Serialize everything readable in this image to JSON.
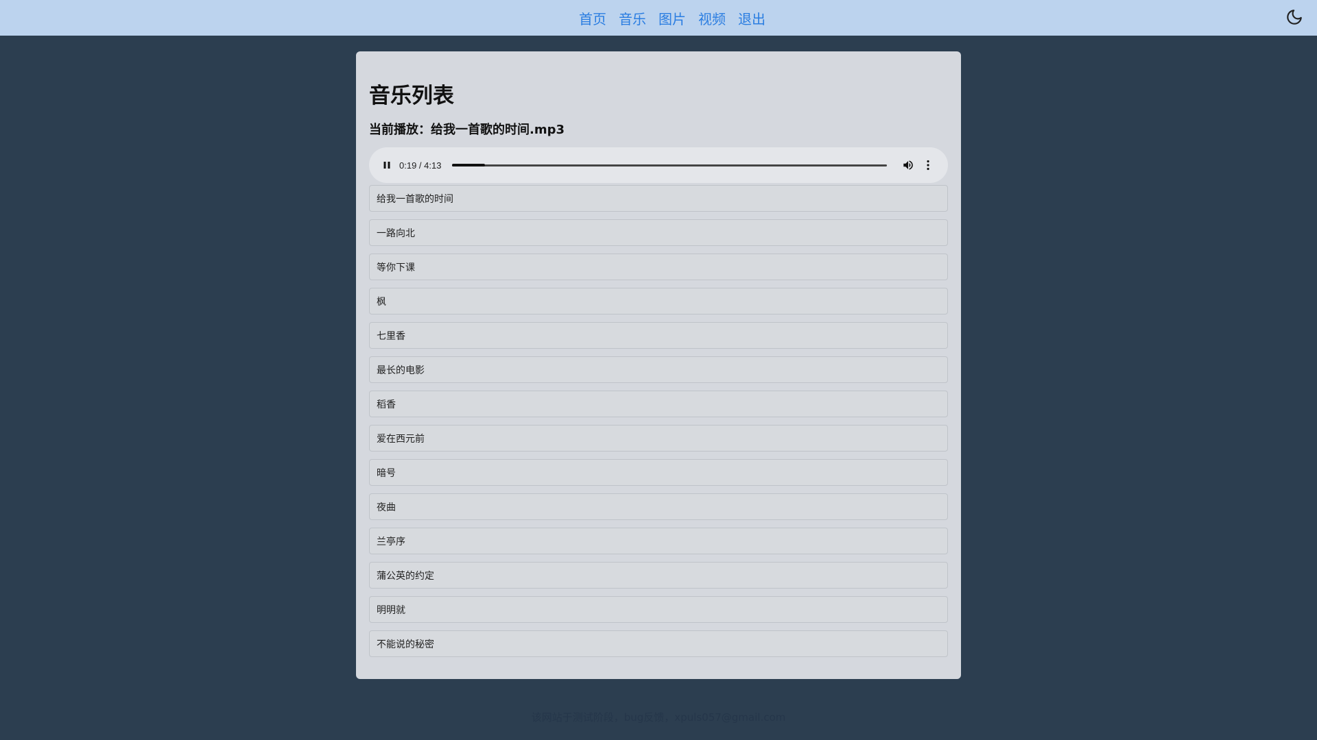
{
  "nav": {
    "items": [
      {
        "label": "首页"
      },
      {
        "label": "音乐"
      },
      {
        "label": "图片"
      },
      {
        "label": "视频"
      },
      {
        "label": "退出"
      }
    ],
    "theme_icon": "moon-icon"
  },
  "main": {
    "title": "音乐列表",
    "now_playing": "当前播放：给我一首歌的时间.mp3"
  },
  "player": {
    "time": "0:19 / 4:13",
    "progress": 0.075,
    "play_icon": "pause-icon",
    "volume_icon": "volume-icon",
    "more_icon": "more-vertical-icon"
  },
  "songs": [
    "给我一首歌的时间",
    "一路向北",
    "等你下课",
    "枫",
    "七里香",
    "最长的电影",
    "稻香",
    "爱在西元前",
    "暗号",
    "夜曲",
    "兰亭序",
    "蒲公英的约定",
    "明明就",
    "不能说的秘密"
  ],
  "footer": {
    "text": "该网站于测试阶段，bug反馈，xpuls057@gmail.com"
  },
  "colors": {
    "nav_bg": "#bcd3ee",
    "page_bg": "#2c3e50",
    "link": "#2a7de1",
    "panel_bg": "#d5d8de"
  }
}
